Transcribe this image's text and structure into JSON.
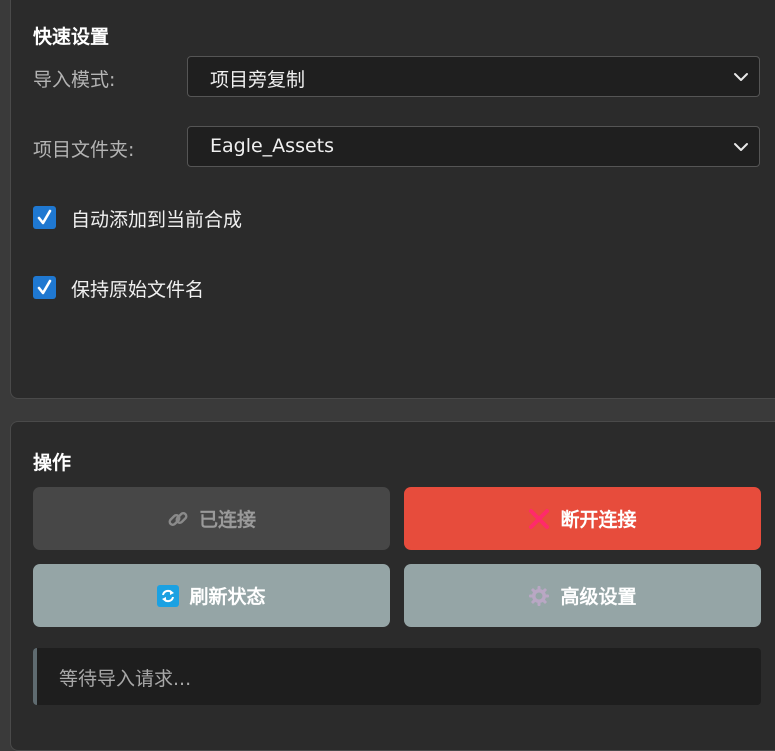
{
  "quick_settings": {
    "title": "快速设置",
    "import_mode": {
      "label": "导入模式:",
      "value": "项目旁复制"
    },
    "project_folder": {
      "label": "项目文件夹:",
      "value": "Eagle_Assets"
    },
    "checkboxes": [
      {
        "label": "自动添加到当前合成",
        "checked": true
      },
      {
        "label": "保持原始文件名",
        "checked": true
      }
    ]
  },
  "operations": {
    "title": "操作",
    "buttons": {
      "connected": {
        "label": "已连接",
        "icon": "link-icon"
      },
      "disconnect": {
        "label": "断开连接",
        "icon": "close-icon",
        "color": "#e74c3c"
      },
      "refresh": {
        "label": "刷新状态",
        "icon": "refresh-icon",
        "color": "#95a5a6"
      },
      "advanced": {
        "label": "高级设置",
        "icon": "gear-icon",
        "color": "#95a5a6"
      }
    },
    "status": "等待导入请求..."
  },
  "colors": {
    "checkbox": "#1f78d1",
    "danger": "#e74c3c",
    "neutral": "#95a5a6",
    "refresh_icon": "#1ba1e2"
  }
}
